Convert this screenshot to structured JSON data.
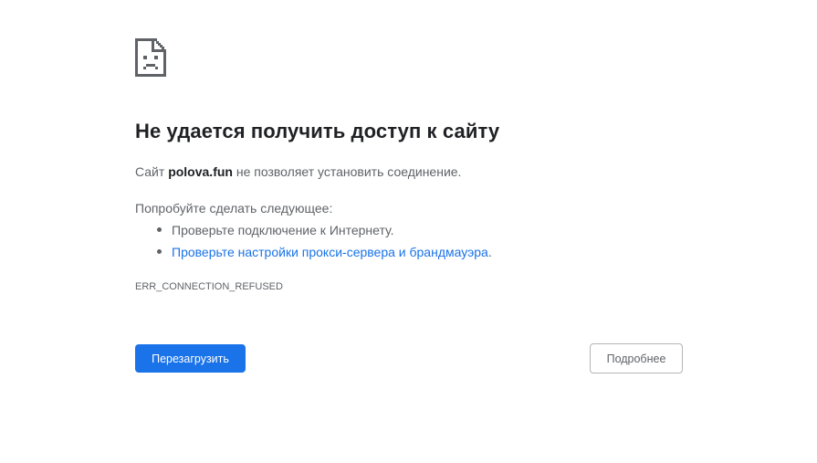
{
  "icon": "sad-document-icon",
  "error": {
    "title": "Не удается получить доступ к сайту",
    "desc_prefix": "Сайт ",
    "site": "polova.fun",
    "desc_suffix": " не позволяет установить соединение.",
    "suggestions_label": "Попробуйте сделать следующее:",
    "suggestions": [
      {
        "text": "Проверьте подключение к Интернету."
      },
      {
        "link_text": "Проверьте настройки прокси-сервера и брандмауэра",
        "after": "."
      }
    ],
    "code": "ERR_CONNECTION_REFUSED"
  },
  "buttons": {
    "reload": "Перезагрузить",
    "details": "Подробнее"
  },
  "colors": {
    "accent": "#1a73e8",
    "title": "#202124",
    "text": "#5f6368"
  }
}
